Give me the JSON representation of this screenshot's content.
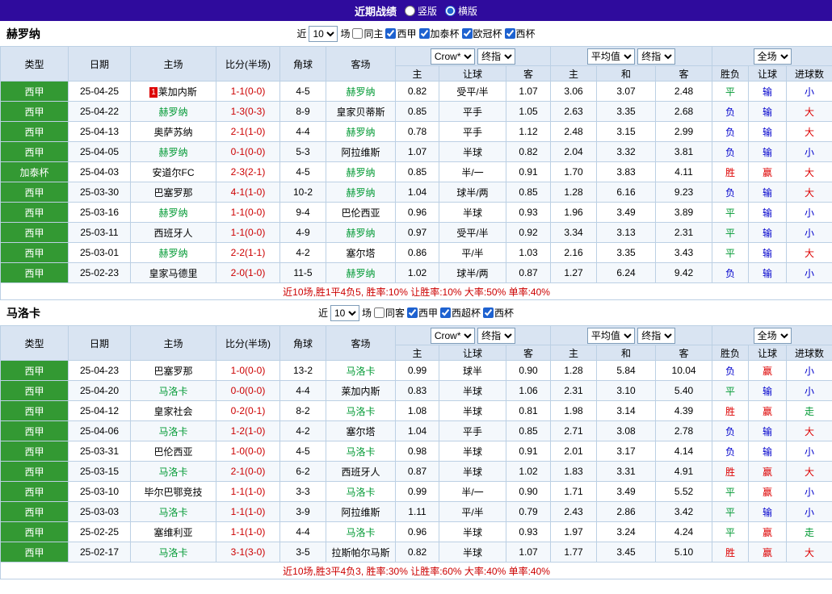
{
  "topbar": {
    "title": "近期战绩",
    "vertical_label": "竖版",
    "horizontal_label": "横版"
  },
  "dropdowns": {
    "source": "Crow*",
    "final": "终指",
    "average": "平均值",
    "scope": "全场"
  },
  "columns": {
    "type": "类型",
    "date": "日期",
    "home": "主场",
    "score": "比分(半场)",
    "corners": "角球",
    "away": "客场",
    "sub": [
      "主",
      "让球",
      "客",
      "主",
      "和",
      "客",
      "胜负",
      "让球",
      "进球数"
    ]
  },
  "colors": {
    "topbar_bg": "#2f0b9d",
    "header_bg": "#d9e4f2",
    "type_green": "#339933",
    "team_green": "#009933",
    "win_red": "#dd0000",
    "draw_green": "#009933",
    "lose_blue": "#0000cc",
    "score_red": "#cc0000"
  },
  "sections": [
    {
      "team": "赫罗纳",
      "filter": {
        "near_label": "近",
        "count": "10",
        "games_label": "场",
        "same_label": "同主",
        "leagues": [
          "西甲",
          "加泰杯",
          "欧冠杯",
          "西杯"
        ]
      },
      "rows": [
        {
          "type": "西甲",
          "date": "25-04-25",
          "home": "莱加内斯",
          "home_badge": "1",
          "score": "1-1(0-0)",
          "corners": "4-5",
          "away": "赫罗纳",
          "odds": [
            "0.82",
            "受平/半",
            "1.07"
          ],
          "avg": [
            "3.06",
            "3.07",
            "2.48"
          ],
          "results": [
            "平",
            "输",
            "小"
          ]
        },
        {
          "type": "西甲",
          "date": "25-04-22",
          "home": "赫罗纳",
          "score": "1-3(0-3)",
          "corners": "8-9",
          "away": "皇家贝蒂斯",
          "odds": [
            "0.85",
            "平手",
            "1.05"
          ],
          "avg": [
            "2.63",
            "3.35",
            "2.68"
          ],
          "results": [
            "负",
            "输",
            "大"
          ]
        },
        {
          "type": "西甲",
          "date": "25-04-13",
          "home": "奥萨苏纳",
          "score": "2-1(1-0)",
          "corners": "4-4",
          "away": "赫罗纳",
          "odds": [
            "0.78",
            "平手",
            "1.12"
          ],
          "avg": [
            "2.48",
            "3.15",
            "2.99"
          ],
          "results": [
            "负",
            "输",
            "大"
          ]
        },
        {
          "type": "西甲",
          "date": "25-04-05",
          "home": "赫罗纳",
          "score": "0-1(0-0)",
          "corners": "5-3",
          "away": "阿拉维斯",
          "odds": [
            "1.07",
            "半球",
            "0.82"
          ],
          "avg": [
            "2.04",
            "3.32",
            "3.81"
          ],
          "results": [
            "负",
            "输",
            "小"
          ]
        },
        {
          "type": "加泰杯",
          "date": "25-04-03",
          "home": "安道尔FC",
          "score": "2-3(2-1)",
          "corners": "4-5",
          "away": "赫罗纳",
          "odds": [
            "0.85",
            "半/一",
            "0.91"
          ],
          "avg": [
            "1.70",
            "3.83",
            "4.11"
          ],
          "results": [
            "胜",
            "赢",
            "大"
          ]
        },
        {
          "type": "西甲",
          "date": "25-03-30",
          "home": "巴塞罗那",
          "score": "4-1(1-0)",
          "corners": "10-2",
          "away": "赫罗纳",
          "odds": [
            "1.04",
            "球半/两",
            "0.85"
          ],
          "avg": [
            "1.28",
            "6.16",
            "9.23"
          ],
          "results": [
            "负",
            "输",
            "大"
          ]
        },
        {
          "type": "西甲",
          "date": "25-03-16",
          "home": "赫罗纳",
          "score": "1-1(0-0)",
          "corners": "9-4",
          "away": "巴伦西亚",
          "odds": [
            "0.96",
            "半球",
            "0.93"
          ],
          "avg": [
            "1.96",
            "3.49",
            "3.89"
          ],
          "results": [
            "平",
            "输",
            "小"
          ]
        },
        {
          "type": "西甲",
          "date": "25-03-11",
          "home": "西班牙人",
          "score": "1-1(0-0)",
          "corners": "4-9",
          "away": "赫罗纳",
          "odds": [
            "0.97",
            "受平/半",
            "0.92"
          ],
          "avg": [
            "3.34",
            "3.13",
            "2.31"
          ],
          "results": [
            "平",
            "输",
            "小"
          ]
        },
        {
          "type": "西甲",
          "date": "25-03-01",
          "home": "赫罗纳",
          "score": "2-2(1-1)",
          "corners": "4-2",
          "away": "塞尔塔",
          "odds": [
            "0.86",
            "平/半",
            "1.03"
          ],
          "avg": [
            "2.16",
            "3.35",
            "3.43"
          ],
          "results": [
            "平",
            "输",
            "大"
          ]
        },
        {
          "type": "西甲",
          "date": "25-02-23",
          "home": "皇家马德里",
          "score": "2-0(1-0)",
          "corners": "11-5",
          "away": "赫罗纳",
          "odds": [
            "1.02",
            "球半/两",
            "0.87"
          ],
          "avg": [
            "1.27",
            "6.24",
            "9.42"
          ],
          "results": [
            "负",
            "输",
            "小"
          ]
        }
      ],
      "summary": "近10场,胜1平4负5, 胜率:10% 让胜率:10% 大率:50% 单率:40%"
    },
    {
      "team": "马洛卡",
      "filter": {
        "near_label": "近",
        "count": "10",
        "games_label": "场",
        "same_label": "同客",
        "leagues": [
          "西甲",
          "西超杯",
          "西杯"
        ]
      },
      "rows": [
        {
          "type": "西甲",
          "date": "25-04-23",
          "home": "巴塞罗那",
          "score": "1-0(0-0)",
          "corners": "13-2",
          "away": "马洛卡",
          "odds": [
            "0.99",
            "球半",
            "0.90"
          ],
          "avg": [
            "1.28",
            "5.84",
            "10.04"
          ],
          "results": [
            "负",
            "赢",
            "小"
          ]
        },
        {
          "type": "西甲",
          "date": "25-04-20",
          "home": "马洛卡",
          "score": "0-0(0-0)",
          "corners": "4-4",
          "away": "莱加内斯",
          "odds": [
            "0.83",
            "半球",
            "1.06"
          ],
          "avg": [
            "2.31",
            "3.10",
            "5.40"
          ],
          "results": [
            "平",
            "输",
            "小"
          ]
        },
        {
          "type": "西甲",
          "date": "25-04-12",
          "home": "皇家社会",
          "score": "0-2(0-1)",
          "corners": "8-2",
          "away": "马洛卡",
          "odds": [
            "1.08",
            "半球",
            "0.81"
          ],
          "avg": [
            "1.98",
            "3.14",
            "4.39"
          ],
          "results": [
            "胜",
            "赢",
            "走"
          ]
        },
        {
          "type": "西甲",
          "date": "25-04-06",
          "home": "马洛卡",
          "score": "1-2(1-0)",
          "corners": "4-2",
          "away": "塞尔塔",
          "odds": [
            "1.04",
            "平手",
            "0.85"
          ],
          "avg": [
            "2.71",
            "3.08",
            "2.78"
          ],
          "results": [
            "负",
            "输",
            "大"
          ]
        },
        {
          "type": "西甲",
          "date": "25-03-31",
          "home": "巴伦西亚",
          "score": "1-0(0-0)",
          "corners": "4-5",
          "away": "马洛卡",
          "odds": [
            "0.98",
            "半球",
            "0.91"
          ],
          "avg": [
            "2.01",
            "3.17",
            "4.14"
          ],
          "results": [
            "负",
            "输",
            "小"
          ]
        },
        {
          "type": "西甲",
          "date": "25-03-15",
          "home": "马洛卡",
          "score": "2-1(0-0)",
          "corners": "6-2",
          "away": "西班牙人",
          "odds": [
            "0.87",
            "半球",
            "1.02"
          ],
          "avg": [
            "1.83",
            "3.31",
            "4.91"
          ],
          "results": [
            "胜",
            "赢",
            "大"
          ]
        },
        {
          "type": "西甲",
          "date": "25-03-10",
          "home": "毕尔巴鄂竞技",
          "score": "1-1(1-0)",
          "corners": "3-3",
          "away": "马洛卡",
          "odds": [
            "0.99",
            "半/一",
            "0.90"
          ],
          "avg": [
            "1.71",
            "3.49",
            "5.52"
          ],
          "results": [
            "平",
            "赢",
            "小"
          ]
        },
        {
          "type": "西甲",
          "date": "25-03-03",
          "home": "马洛卡",
          "score": "1-1(1-0)",
          "corners": "3-9",
          "away": "阿拉维斯",
          "odds": [
            "1.11",
            "平/半",
            "0.79"
          ],
          "avg": [
            "2.43",
            "2.86",
            "3.42"
          ],
          "results": [
            "平",
            "输",
            "小"
          ]
        },
        {
          "type": "西甲",
          "date": "25-02-25",
          "home": "塞维利亚",
          "score": "1-1(1-0)",
          "corners": "4-4",
          "away": "马洛卡",
          "odds": [
            "0.96",
            "半球",
            "0.93"
          ],
          "avg": [
            "1.97",
            "3.24",
            "4.24"
          ],
          "results": [
            "平",
            "赢",
            "走"
          ]
        },
        {
          "type": "西甲",
          "date": "25-02-17",
          "home": "马洛卡",
          "score": "3-1(3-0)",
          "corners": "3-5",
          "away": "拉斯帕尔马斯",
          "odds": [
            "0.82",
            "半球",
            "1.07"
          ],
          "avg": [
            "1.77",
            "3.45",
            "5.10"
          ],
          "results": [
            "胜",
            "赢",
            "大"
          ]
        }
      ],
      "summary": "近10场,胜3平4负3, 胜率:30% 让胜率:60% 大率:40% 单率:40%"
    }
  ]
}
